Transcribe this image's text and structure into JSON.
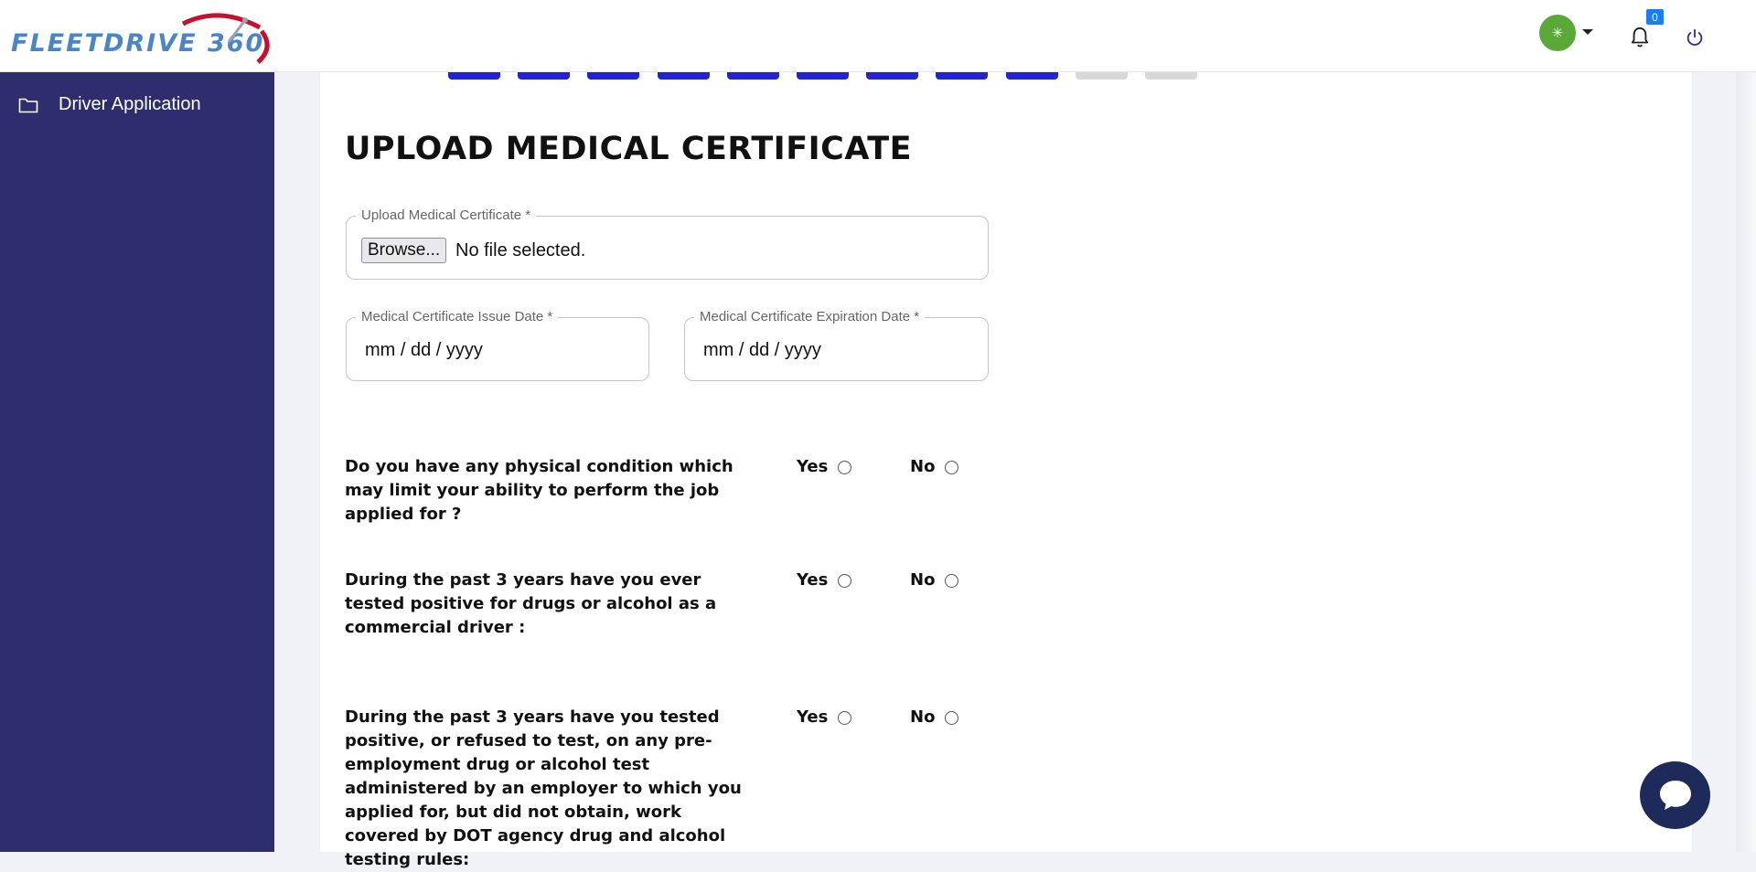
{
  "header": {
    "logo_text": "FLEETDRIVE 360",
    "avatar_glyph": "✳",
    "notification_count": "0"
  },
  "sidebar": {
    "items": [
      {
        "label": "Driver Application",
        "icon": "folder-icon"
      }
    ]
  },
  "progress": {
    "total_steps": 11,
    "completed_steps": 9
  },
  "page": {
    "title": "UPLOAD MEDICAL CERTIFICATE"
  },
  "form": {
    "upload": {
      "label": "Upload Medical Certificate *",
      "button_label": "Browse...",
      "status": "No file selected."
    },
    "issue_date": {
      "label": "Medical Certificate Issue Date *",
      "placeholder": "mm / dd / yyyy"
    },
    "expiration_date": {
      "label": "Medical Certificate Expiration Date *",
      "placeholder": "mm / dd / yyyy"
    },
    "questions": [
      {
        "text": "Do you have any physical condition which may limit your ability to perform the job applied for ?",
        "yes": "Yes",
        "no": "No"
      },
      {
        "text": "During the past 3 years have you ever tested positive for drugs or alcohol as a commercial driver :",
        "yes": "Yes",
        "no": "No"
      },
      {
        "text": "During the past 3 years have you tested positive, or refused to test, on any pre-employment drug or alcohol test administered by an employer to which you applied for, but did not obtain, work covered by DOT agency drug and alcohol testing rules:",
        "yes": "Yes",
        "no": "No"
      }
    ]
  },
  "colors": {
    "sidebar": "#2e2e6e",
    "step_done": "#2323d6",
    "step_todo": "#d8d8d8",
    "avatar": "#5aa838",
    "badge": "#1b7cf4",
    "chat": "#1e2a5a"
  }
}
